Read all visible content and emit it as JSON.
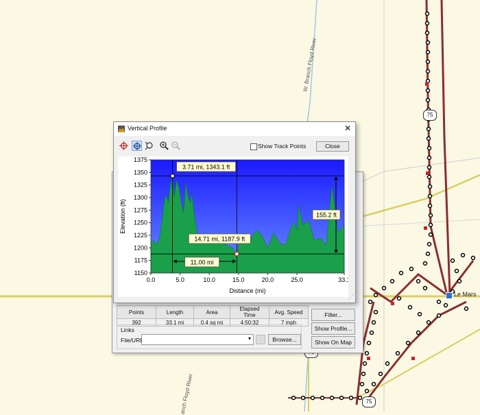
{
  "map": {
    "rivers": [
      "W. Branch Floyd River",
      "anch Floyd River"
    ],
    "town": "Le Mars",
    "route_shields": [
      "75",
      "75",
      "75"
    ]
  },
  "vertical_profile": {
    "title": "Vertical Profile",
    "close_x": "✕",
    "tools": [
      "add-point-icon",
      "crosshair-select-icon",
      "measure-icon",
      "zoom-in-icon",
      "zoom-out-icon"
    ],
    "show_track_points_label": "Show Track Points",
    "show_track_points_checked": false,
    "close_label": "Close",
    "grip": "⋰"
  },
  "chart_data": {
    "type": "area",
    "xlabel": "Distance   (mi)",
    "ylabel": "Elevation (ft)",
    "xlim": [
      0,
      33.1
    ],
    "ylim": [
      1150,
      1375
    ],
    "x_ticks": [
      "0.0",
      "5.0",
      "10.0",
      "15.0",
      "20.0",
      "25.0",
      "33.1"
    ],
    "x_tick_values": [
      0,
      5,
      10,
      15,
      20,
      25,
      33.1
    ],
    "y_ticks": [
      "1375",
      "1350",
      "1325",
      "1300",
      "1275",
      "1250",
      "1225",
      "1200",
      "1175",
      "1150"
    ],
    "y_tick_values": [
      1375,
      1350,
      1325,
      1300,
      1275,
      1250,
      1225,
      1200,
      1175,
      1150
    ],
    "series": [
      {
        "x": [
          0,
          0.5,
          1,
          1.5,
          2,
          2.2,
          2.6,
          3,
          3.3,
          3.71,
          4,
          4.4,
          4.8,
          5.2,
          5.6,
          6,
          6.4,
          6.8,
          7,
          7.5,
          8,
          8.5,
          9,
          10,
          11,
          12,
          13,
          14,
          14.71,
          15,
          16,
          17,
          18,
          19,
          20,
          21,
          22,
          23,
          24,
          24.5,
          25,
          25.3,
          26,
          27,
          28,
          29,
          30,
          31,
          31.5,
          32,
          33.1
        ],
        "y": [
          1210,
          1215,
          1205,
          1220,
          1260,
          1285,
          1305,
          1290,
          1320,
          1343.1,
          1300,
          1335,
          1320,
          1290,
          1270,
          1330,
          1300,
          1290,
          1310,
          1260,
          1225,
          1215,
          1230,
          1210,
          1220,
          1215,
          1205,
          1200,
          1187.9,
          1205,
          1230,
          1215,
          1235,
          1225,
          1200,
          1230,
          1210,
          1205,
          1240,
          1250,
          1235,
          1285,
          1245,
          1255,
          1215,
          1220,
          1205,
          1325,
          1280,
          1230,
          1245
        ]
      }
    ],
    "annotations": {
      "high_point": "3.71 mi, 1343.1 ft",
      "low_point": "14.71 mi, 1187.9 ft",
      "elevation_delta": "155.2 ft",
      "distance_delta": "11.00 mi"
    },
    "markers": {
      "p1": [
        3.71,
        1343.1
      ],
      "p2": [
        14.71,
        1187.9
      ]
    },
    "colors": {
      "sky_top": "#1a1aff",
      "sky_bottom": "#6a90ff",
      "terrain": "#1aa04a"
    }
  },
  "track_properties": {
    "stats_headers": [
      "Points",
      "Length",
      "Area",
      "Elapsed Time",
      "Avg. Speed"
    ],
    "stats_values": [
      "392",
      "33.1 mi",
      "0.4 sq mi",
      "4:50:32",
      "7 mph"
    ],
    "filter_button": "Filter...",
    "show_profile_button": "Show Profile...",
    "show_on_map_button": "Show On Map",
    "links_label": "Links",
    "file_url_label": "File/URL:",
    "file_url_value": "",
    "dropdown_arrow": "▾",
    "browse_button": "Browse..."
  }
}
